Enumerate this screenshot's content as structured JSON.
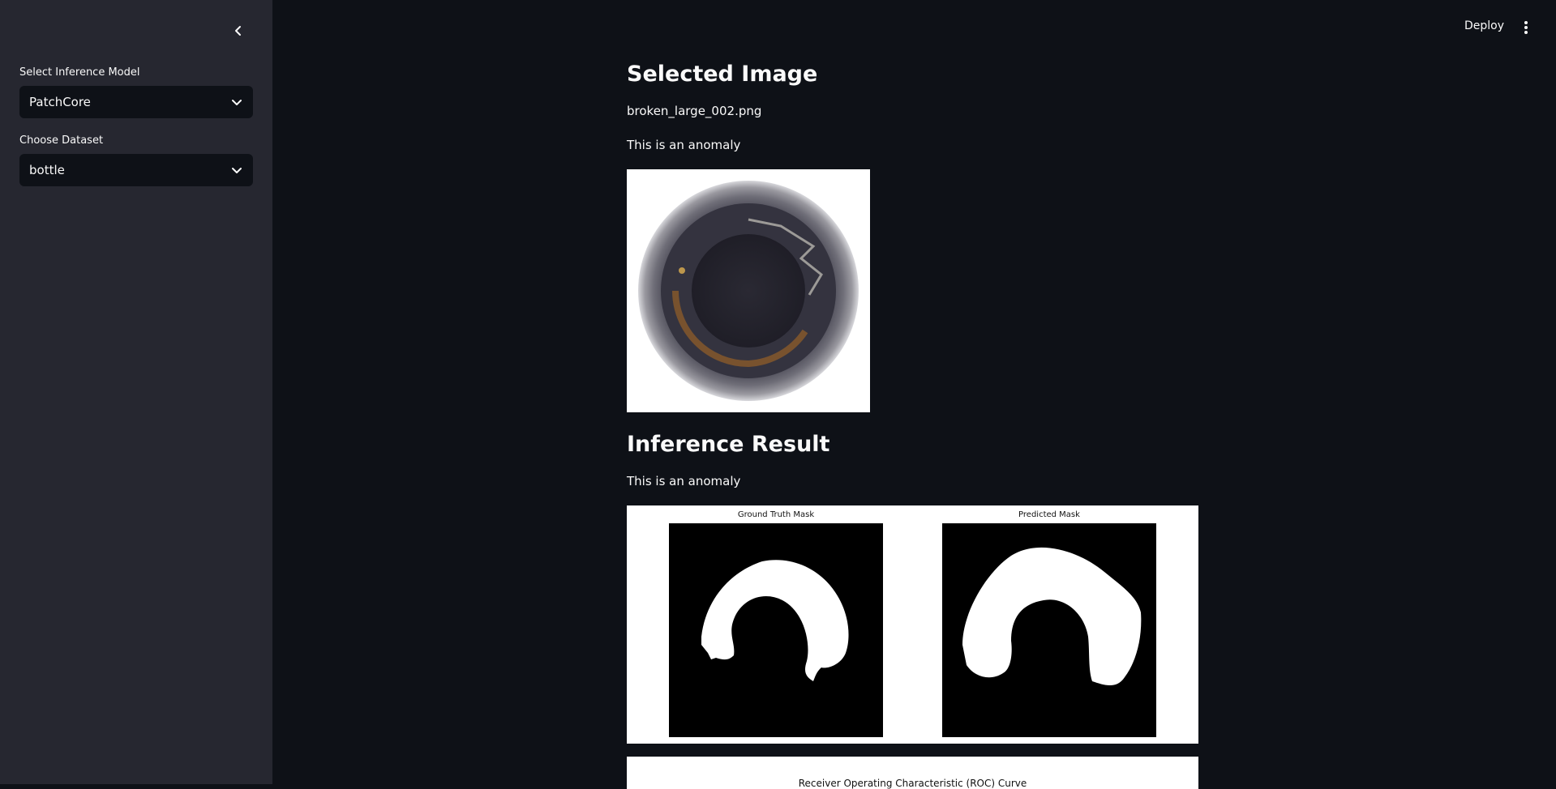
{
  "sidebar": {
    "model_label": "Select Inference Model",
    "model_value": "PatchCore",
    "dataset_label": "Choose Dataset",
    "dataset_value": "bottle"
  },
  "header": {
    "deploy_label": "Deploy"
  },
  "main": {
    "selected_heading": "Selected Image",
    "filename": "broken_large_002.png",
    "selected_status": "This is an anomaly",
    "result_heading": "Inference Result",
    "result_status": "This is an anomaly",
    "gt_title": "Ground Truth Mask",
    "pred_title": "Predicted Mask",
    "roc_title": "Receiver Operating Characteristic (ROC) Curve"
  },
  "colors": {
    "app_bg": "#0e1117",
    "sidebar_bg": "#262730",
    "text": "#fafafa"
  }
}
